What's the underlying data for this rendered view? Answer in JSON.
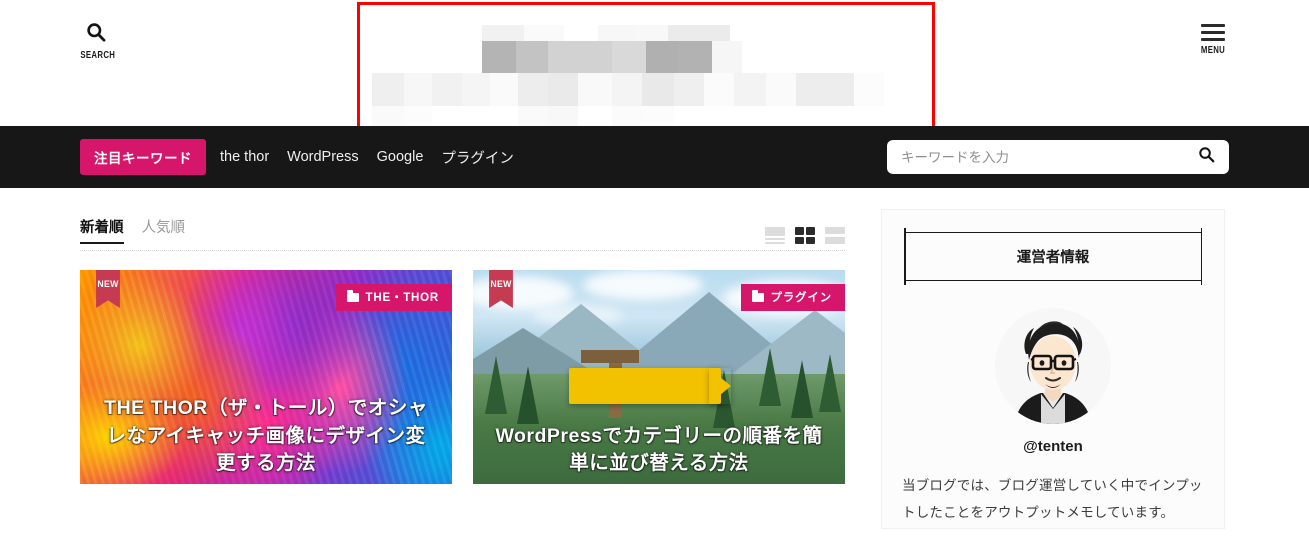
{
  "header": {
    "search_label": "SEARCH",
    "search_icon": "magnifier-icon",
    "menu_label": "MENU",
    "menu_icon": "hamburger-icon",
    "logo_area_note": "mosaic-censored-logo",
    "highlight_color": "#fe0000"
  },
  "navbar": {
    "background": "#171717",
    "keyword_badge": "注目キーワード",
    "accent_color": "#d6166b",
    "links": [
      {
        "label": "the thor"
      },
      {
        "label": "WordPress"
      },
      {
        "label": "Google"
      },
      {
        "label": "プラグイン"
      }
    ],
    "search": {
      "placeholder": "キーワードを入力",
      "value": "",
      "icon": "search-icon"
    }
  },
  "toolbar": {
    "tabs": [
      {
        "label": "新着順",
        "active": true
      },
      {
        "label": "人気順",
        "active": false
      }
    ],
    "views": [
      {
        "name": "list-view",
        "active": false
      },
      {
        "name": "grid-view",
        "active": true
      },
      {
        "name": "card-view",
        "active": false
      }
    ]
  },
  "articles": [
    {
      "badge": "NEW",
      "category": "THE・THOR",
      "category_icon": "folder-icon",
      "title": "THE THOR（ザ・トール）でオシャレなアイキャッチ画像にデザイン変更する方法",
      "thumbnail": "colorful-paint-splash"
    },
    {
      "badge": "NEW",
      "category": "プラグイン",
      "category_icon": "folder-icon",
      "title": "WordPressでカテゴリーの順番を簡単に並び替える方法",
      "thumbnail": "mountain-signpost-photo"
    }
  ],
  "sidebar": {
    "widget_title": "運営者情報",
    "avatar_alt": "avatar-illustration",
    "handle": "@tenten",
    "bio": "当ブログでは、ブログ運営していく中でインプットしたことをアウトプットメモしています。"
  }
}
